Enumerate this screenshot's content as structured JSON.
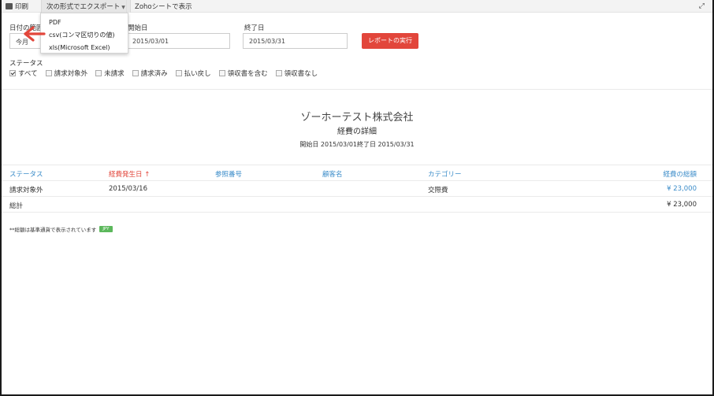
{
  "toolbar": {
    "print_label": "印刷",
    "export_label": "次の形式でエクスポート",
    "zoho_label": "Zohoシートで表示"
  },
  "export_menu": {
    "items": [
      "PDF",
      "csv(コンマ区切りの値)",
      "xls(Microsoft Excel)"
    ]
  },
  "filters": {
    "range_label": "日付の範囲",
    "range_value": "今月",
    "start_label": "開始日",
    "start_value": "2015/03/01",
    "end_label": "終了日",
    "end_value": "2015/03/31",
    "run_button": "レポートの実行",
    "status_label": "ステータス",
    "statuses": [
      {
        "label": "すべて",
        "checked": true
      },
      {
        "label": "請求対象外",
        "checked": false
      },
      {
        "label": "未請求",
        "checked": false
      },
      {
        "label": "請求済み",
        "checked": false
      },
      {
        "label": "払い戻し",
        "checked": false
      },
      {
        "label": "領収書を含む",
        "checked": false
      },
      {
        "label": "領収書なし",
        "checked": false
      }
    ]
  },
  "report": {
    "company": "ゾーホーテスト株式会社",
    "title": "経費の詳細",
    "period": "開始日 2015/03/01終了日 2015/03/31"
  },
  "table": {
    "columns": [
      "ステータス",
      "経費発生日",
      "参照番号",
      "顧客名",
      "カテゴリー",
      "経費の総額"
    ],
    "sort_indicator": "↑",
    "rows": [
      {
        "status": "請求対象外",
        "date": "2015/03/16",
        "ref": "",
        "customer": "",
        "category": "交際費",
        "amount": "¥ 23,000"
      }
    ],
    "total_label": "総計",
    "total_amount": "¥ 23,000"
  },
  "footnote": {
    "text": "**総額は基準通貨で表示されています",
    "currency_badge": "JPY"
  },
  "colors": {
    "accent_blue": "#3b8cc9",
    "accent_red": "#e2463b",
    "badge_green": "#5cb85c"
  }
}
